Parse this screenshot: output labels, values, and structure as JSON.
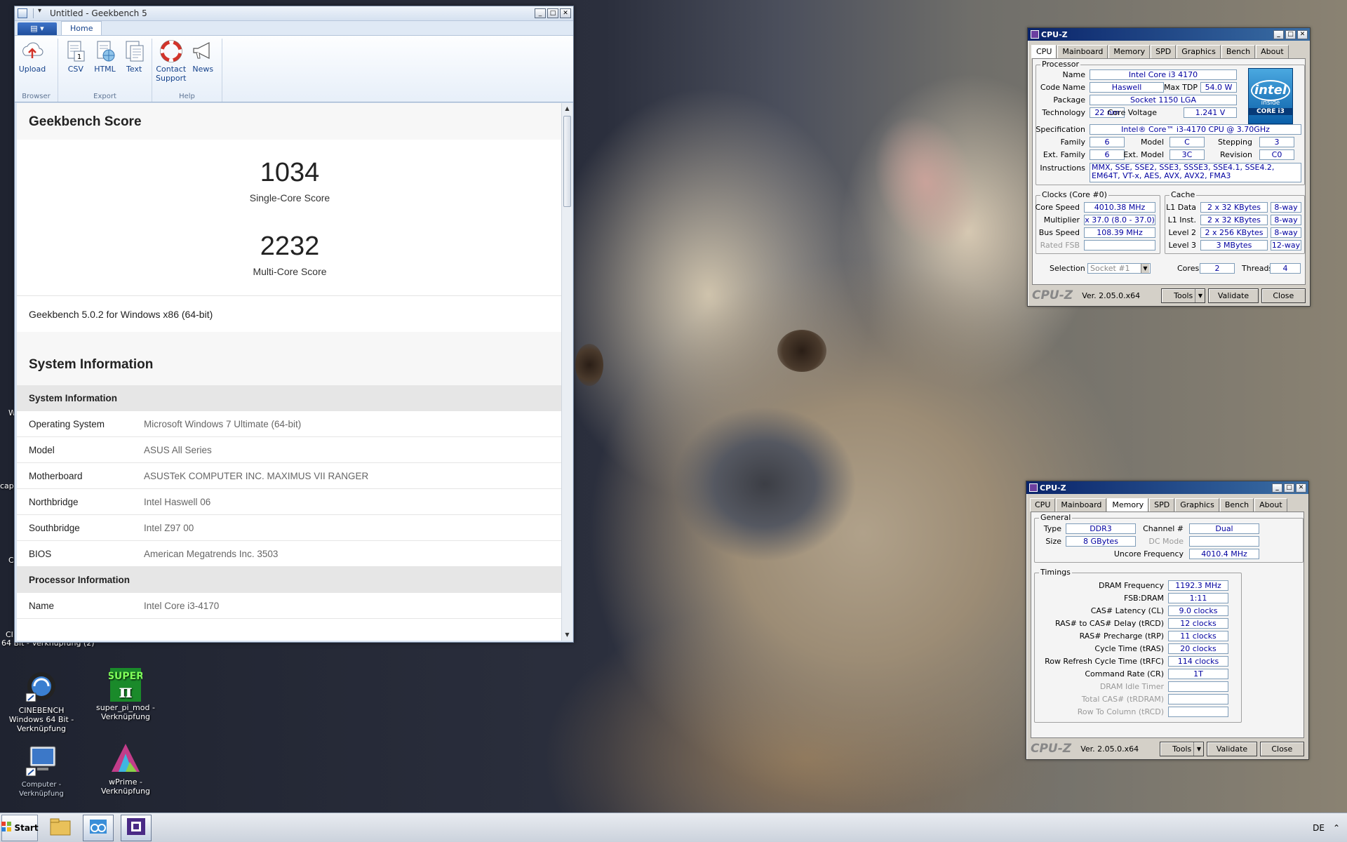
{
  "desktop": {
    "icons": [
      {
        "label": "CINEBENCH Windows 64 Bit - Verknüpfung"
      },
      {
        "label": "super_pi_mod - Verknüpfung"
      },
      {
        "label": "Computer - Verknüpfung"
      },
      {
        "label": "wPrime - Verknüpfung"
      }
    ],
    "edge_texts": [
      "cap",
      "CIN",
      "64 Bit - Verknüpfung (2)",
      "C",
      "W"
    ]
  },
  "geekbench": {
    "title": "Untitled - Geekbench 5",
    "ribbon": {
      "tab": "Home",
      "groups": [
        {
          "label": "Browser",
          "buttons": [
            "Upload"
          ]
        },
        {
          "label": "Export",
          "buttons": [
            "CSV",
            "HTML",
            "Text"
          ]
        },
        {
          "label": "Help",
          "buttons": [
            "Contact Support",
            "News"
          ]
        }
      ]
    },
    "score_heading": "Geekbench Score",
    "single": {
      "value": "1034",
      "label": "Single-Core Score"
    },
    "multi": {
      "value": "2232",
      "label": "Multi-Core Score"
    },
    "version": "Geekbench 5.0.2 for Windows x86 (64-bit)",
    "sysinfo_heading": "System Information",
    "groups": [
      {
        "title": "System Information",
        "rows": [
          {
            "k": "Operating System",
            "v": "Microsoft Windows 7 Ultimate (64-bit)"
          },
          {
            "k": "Model",
            "v": "ASUS All Series"
          },
          {
            "k": "Motherboard",
            "v": "ASUSTeK COMPUTER INC. MAXIMUS VII RANGER"
          },
          {
            "k": "Northbridge",
            "v": "Intel Haswell 06"
          },
          {
            "k": "Southbridge",
            "v": "Intel Z97 00"
          },
          {
            "k": "BIOS",
            "v": "American Megatrends Inc. 3503"
          }
        ]
      },
      {
        "title": "Processor Information",
        "rows": [
          {
            "k": "Name",
            "v": "Intel Core i3-4170"
          }
        ]
      }
    ]
  },
  "cpuz": {
    "title": "CPU-Z",
    "tabs": [
      "CPU",
      "Mainboard",
      "Memory",
      "SPD",
      "Graphics",
      "Bench",
      "About"
    ],
    "logo": "CPU-Z",
    "version": "Ver. 2.05.0.x64",
    "buttons": {
      "tools": "Tools",
      "validate": "Validate",
      "close": "Close"
    },
    "cpu": {
      "processor_legend": "Processor",
      "name_l": "Name",
      "name": "Intel Core i3 4170",
      "codename_l": "Code Name",
      "codename": "Haswell",
      "maxtdp_l": "Max TDP",
      "maxtdp": "54.0 W",
      "package_l": "Package",
      "package": "Socket 1150 LGA",
      "tech_l": "Technology",
      "tech": "22 nm",
      "voltage_l": "Core Voltage",
      "voltage": "1.241 V",
      "spec_l": "Specification",
      "spec": "Intel® Core™ i3-4170 CPU @ 3.70GHz",
      "family_l": "Family",
      "family": "6",
      "model_l": "Model",
      "model": "C",
      "stepping_l": "Stepping",
      "stepping": "3",
      "extfamily_l": "Ext. Family",
      "extfamily": "6",
      "extmodel_l": "Ext. Model",
      "extmodel": "3C",
      "revision_l": "Revision",
      "revision": "C0",
      "instr_l": "Instructions",
      "instr": "MMX, SSE, SSE2, SSE3, SSSE3, SSE4.1, SSE4.2, EM64T, VT-x, AES, AVX, AVX2, FMA3",
      "clocks_legend": "Clocks (Core #0)",
      "corespeed_l": "Core Speed",
      "corespeed": "4010.38 MHz",
      "mult_l": "Multiplier",
      "mult": "x 37.0 (8.0 - 37.0)",
      "bus_l": "Bus Speed",
      "bus": "108.39 MHz",
      "fsb_l": "Rated FSB",
      "fsb": "",
      "cache_legend": "Cache",
      "l1d_l": "L1 Data",
      "l1d": "2 x 32 KBytes",
      "l1d_w": "8-way",
      "l1i_l": "L1 Inst.",
      "l1i": "2 x 32 KBytes",
      "l1i_w": "8-way",
      "l2_l": "Level 2",
      "l2": "2 x 256 KBytes",
      "l2_w": "8-way",
      "l3_l": "Level 3",
      "l3": "3 MBytes",
      "l3_w": "12-way",
      "sel_l": "Selection",
      "sel": "Socket #1",
      "cores_l": "Cores",
      "cores": "2",
      "threads_l": "Threads",
      "threads": "4",
      "intel": {
        "brand": "intel",
        "inside": "inside",
        "core": "CORE i3"
      }
    },
    "mem": {
      "general_legend": "General",
      "type_l": "Type",
      "type": "DDR3",
      "size_l": "Size",
      "size": "8 GBytes",
      "channel_l": "Channel #",
      "channel": "Dual",
      "dcmode_l": "DC Mode",
      "dcmode": "",
      "uncore_l": "Uncore Frequency",
      "uncore": "4010.4 MHz",
      "timings_legend": "Timings",
      "timings": [
        {
          "l": "DRAM Frequency",
          "v": "1192.3 MHz",
          "dim": false
        },
        {
          "l": "FSB:DRAM",
          "v": "1:11",
          "dim": false
        },
        {
          "l": "CAS# Latency (CL)",
          "v": "9.0 clocks",
          "dim": false
        },
        {
          "l": "RAS# to CAS# Delay (tRCD)",
          "v": "12 clocks",
          "dim": false
        },
        {
          "l": "RAS# Precharge (tRP)",
          "v": "11 clocks",
          "dim": false
        },
        {
          "l": "Cycle Time (tRAS)",
          "v": "20 clocks",
          "dim": false
        },
        {
          "l": "Row Refresh Cycle Time (tRFC)",
          "v": "114 clocks",
          "dim": false
        },
        {
          "l": "Command Rate (CR)",
          "v": "1T",
          "dim": false
        },
        {
          "l": "DRAM Idle Timer",
          "v": "",
          "dim": true
        },
        {
          "l": "Total CAS# (tRDRAM)",
          "v": "",
          "dim": true
        },
        {
          "l": "Row To Column (tRCD)",
          "v": "",
          "dim": true
        }
      ]
    }
  },
  "taskbar": {
    "start": "Start",
    "lang": "DE",
    "tray_arrow": "⌃"
  }
}
